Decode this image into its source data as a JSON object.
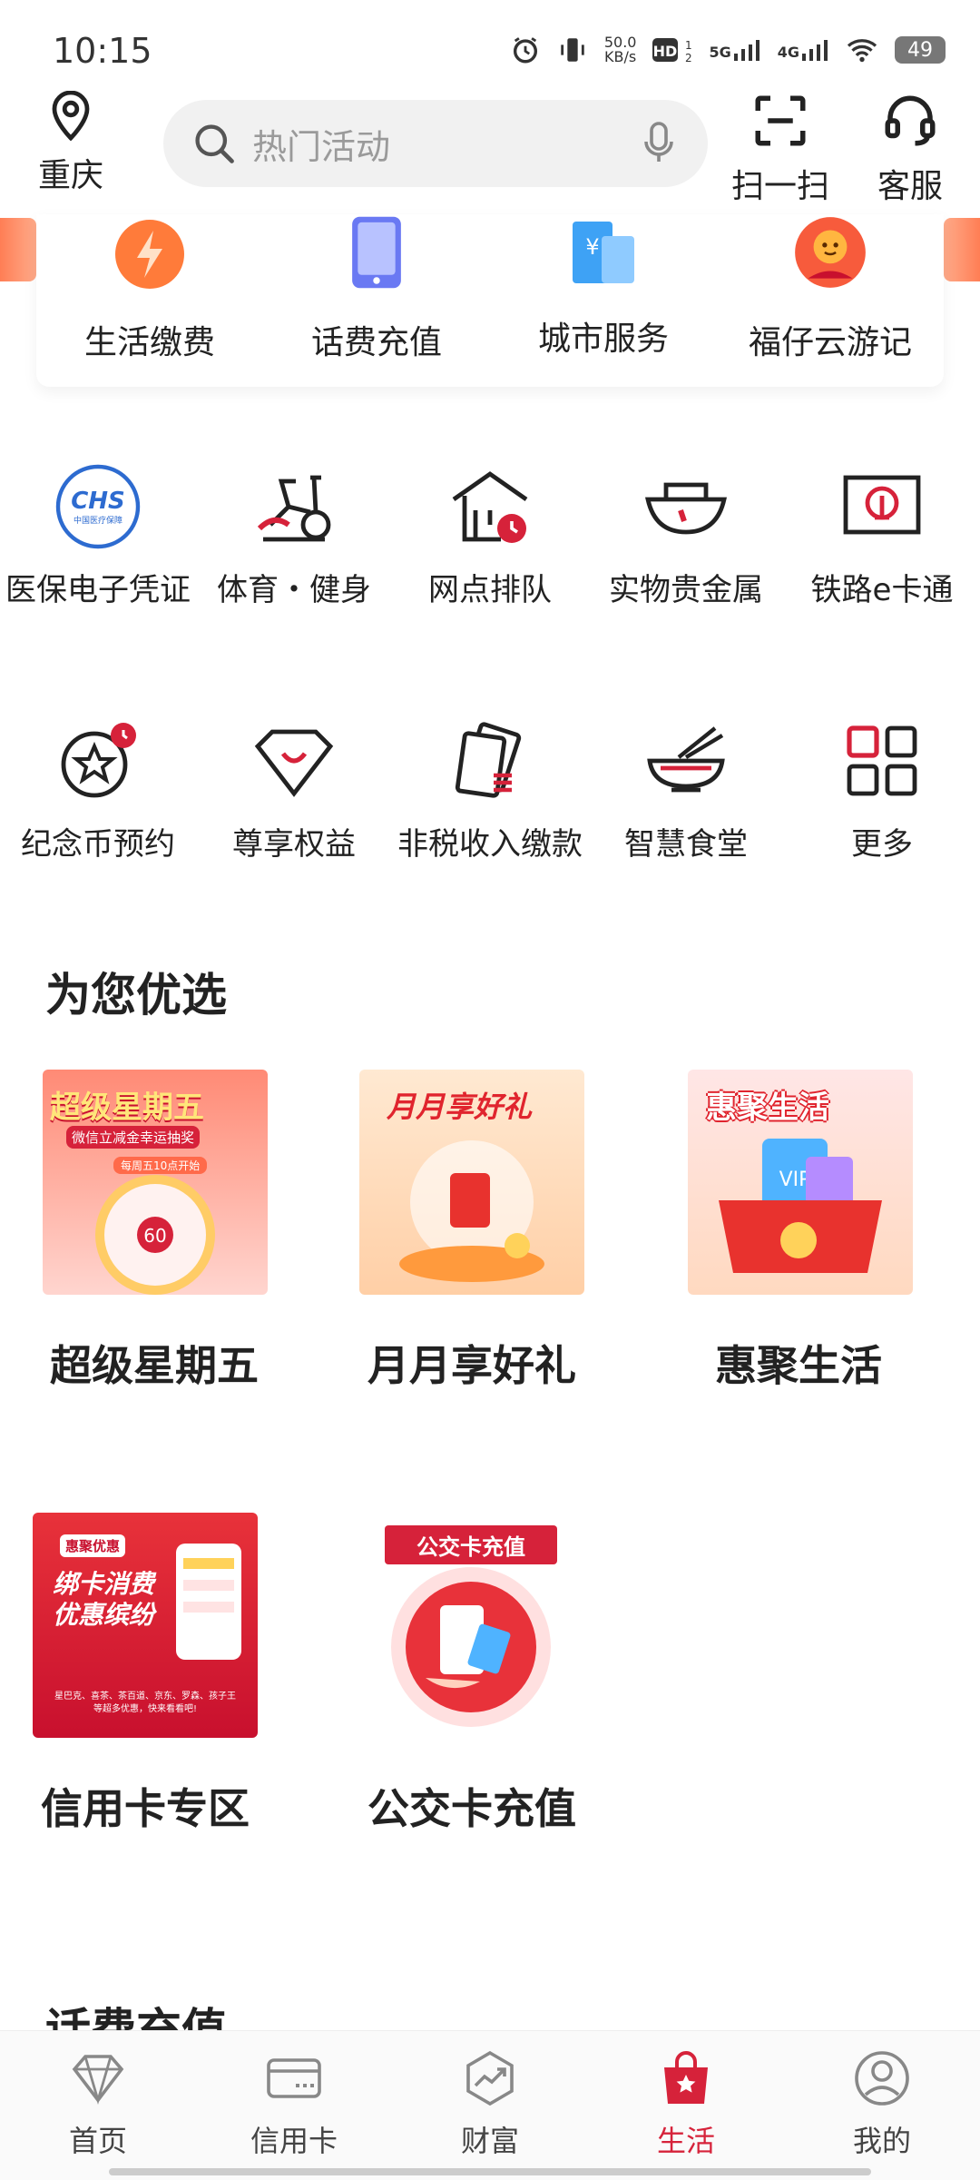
{
  "status_bar": {
    "time": "10:15",
    "net_speed": "50.0\nKB/s",
    "network_5g": "5G",
    "network_4g": "4G",
    "battery": "49"
  },
  "header": {
    "location": "重庆",
    "search_placeholder": "热门活动",
    "scan_label": "扫一扫",
    "service_label": "客服"
  },
  "top_services": [
    {
      "label": "生活缴费",
      "icon": "lightning-icon"
    },
    {
      "label": "话费充值",
      "icon": "phone-icon"
    },
    {
      "label": "城市服务",
      "icon": "city-icon"
    },
    {
      "label": "福仔云游记",
      "icon": "mascot-icon"
    }
  ],
  "grid_row1": [
    {
      "label": "医保电子凭证",
      "icon": "chs-icon"
    },
    {
      "label": "体育・健身",
      "icon": "bike-icon"
    },
    {
      "label": "网点排队",
      "icon": "branch-queue-icon"
    },
    {
      "label": "实物贵金属",
      "icon": "ingot-icon"
    },
    {
      "label": "铁路e卡通",
      "icon": "railway-icon"
    }
  ],
  "grid_row2": [
    {
      "label": "纪念币预约",
      "icon": "coin-icon"
    },
    {
      "label": "尊享权益",
      "icon": "diamond-icon"
    },
    {
      "label": "非税收入缴款",
      "icon": "tax-icon"
    },
    {
      "label": "智慧食堂",
      "icon": "canteen-icon"
    },
    {
      "label": "更多",
      "icon": "more-grid-icon"
    }
  ],
  "chs_logo_text": "CHS",
  "chs_logo_sub": "中国医疗保障",
  "section_title": "为您优选",
  "promos": [
    {
      "label": "超级星期五",
      "banner": "超级星期五",
      "sub": "微信立减金幸运抽奖",
      "sub2": "每周五10点开始",
      "wheel": "60"
    },
    {
      "label": "月月享好礼",
      "banner": "月月享好礼"
    },
    {
      "label": "惠聚生活",
      "banner": "惠聚生活",
      "vip": "VIP"
    },
    {
      "label": "信用卡专区",
      "banner": "绑卡消费\n优惠缤纷",
      "chip": "惠聚优惠",
      "sub": "星巴克、喜茶、茶百道、京东、罗森、孩子王\n等超多优惠，快来看看吧!"
    },
    {
      "label": "公交卡充值",
      "banner": "公交卡充值"
    }
  ],
  "next_section_partial": "话费充值",
  "bottom_nav": [
    {
      "label": "首页",
      "icon": "diamond-outline-icon",
      "active": false
    },
    {
      "label": "信用卡",
      "icon": "credit-card-icon",
      "active": false
    },
    {
      "label": "财富",
      "icon": "wealth-chart-icon",
      "active": false
    },
    {
      "label": "生活",
      "icon": "shopping-bag-icon",
      "active": true
    },
    {
      "label": "我的",
      "icon": "user-icon",
      "active": false
    }
  ],
  "colors": {
    "accent": "#d6223a",
    "orange": "#ff7e55"
  }
}
